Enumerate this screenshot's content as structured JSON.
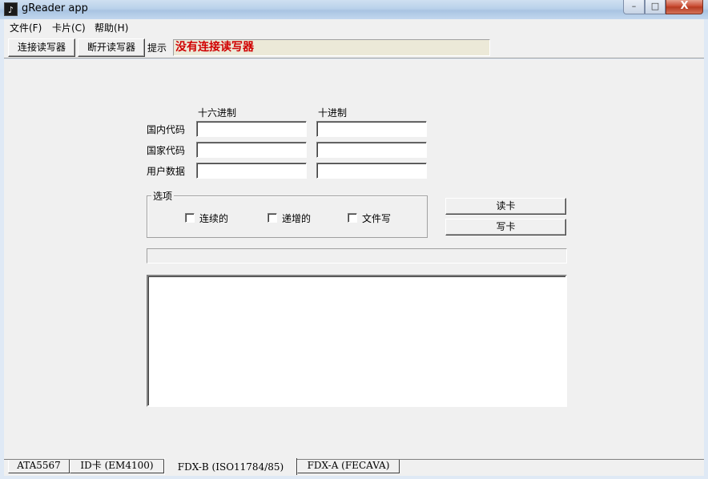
{
  "window": {
    "title": "gReader app",
    "min_glyph": "–",
    "max_glyph": "□",
    "close_glyph": "X"
  },
  "menu": {
    "items": [
      "文件(F)",
      "卡片(C)",
      "帮助(H)"
    ]
  },
  "toolbar": {
    "connect_label": "连接读写器",
    "disconnect_label": "断开读写器",
    "hint_label": "提示",
    "hint_value": "没有连接读写器"
  },
  "form": {
    "col_hex": "十六进制",
    "col_dec": "十进制",
    "rows": [
      {
        "label": "国内代码",
        "hex": "",
        "dec": ""
      },
      {
        "label": "国家代码",
        "hex": "",
        "dec": ""
      },
      {
        "label": "用户数据",
        "hex": "",
        "dec": ""
      }
    ]
  },
  "options": {
    "title": "选项",
    "checkboxes": [
      {
        "label": "连续的",
        "checked": false
      },
      {
        "label": "递增的",
        "checked": false
      },
      {
        "label": "文件写",
        "checked": false
      }
    ]
  },
  "actions": {
    "read_label": "读卡",
    "write_label": "写卡"
  },
  "progress": {
    "value": 0
  },
  "log": {
    "text": ""
  },
  "tabs": [
    {
      "label": "ATA5567",
      "active": false
    },
    {
      "label": "ID卡 (EM4100)",
      "active": false
    },
    {
      "label": "FDX-B (ISO11784/85)",
      "active": true
    },
    {
      "label": "FDX-A (FECAVA)",
      "active": false
    }
  ]
}
